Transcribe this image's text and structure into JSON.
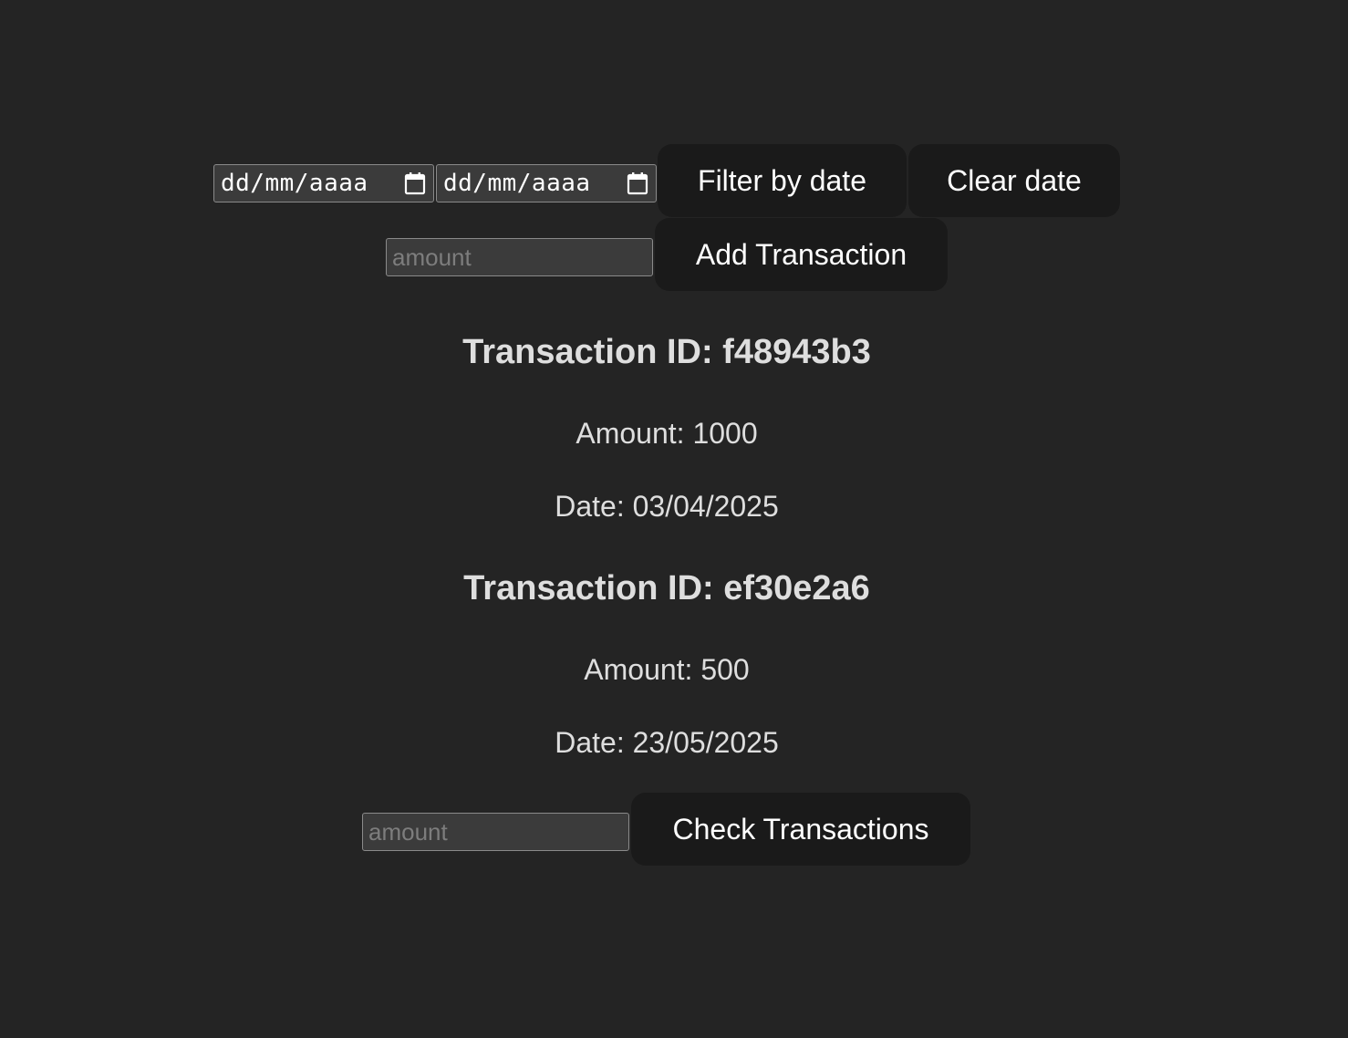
{
  "filter": {
    "start_date_placeholder": "dd/mm/aaaa",
    "end_date_placeholder": "dd/mm/aaaa",
    "filter_label": "Filter by date",
    "clear_label": "Clear date"
  },
  "add": {
    "amount_placeholder": "amount",
    "button_label": "Add Transaction"
  },
  "transactions": [
    {
      "title": "Transaction ID: f48943b3",
      "amount": "Amount: 1000",
      "date": "Date: 03/04/2025"
    },
    {
      "title": "Transaction ID: ef30e2a6",
      "amount": "Amount: 500",
      "date": "Date: 23/05/2025"
    }
  ],
  "check": {
    "amount_placeholder": "amount",
    "button_label": "Check Transactions"
  },
  "icons": {
    "date_picker": "calendar-icon"
  },
  "colors": {
    "background": "#242424",
    "button_bg": "#1a1a1a",
    "input_bg": "#3b3b3b",
    "input_border": "#8a8a8a",
    "placeholder": "#7d7d7d",
    "text": "#dedede"
  }
}
